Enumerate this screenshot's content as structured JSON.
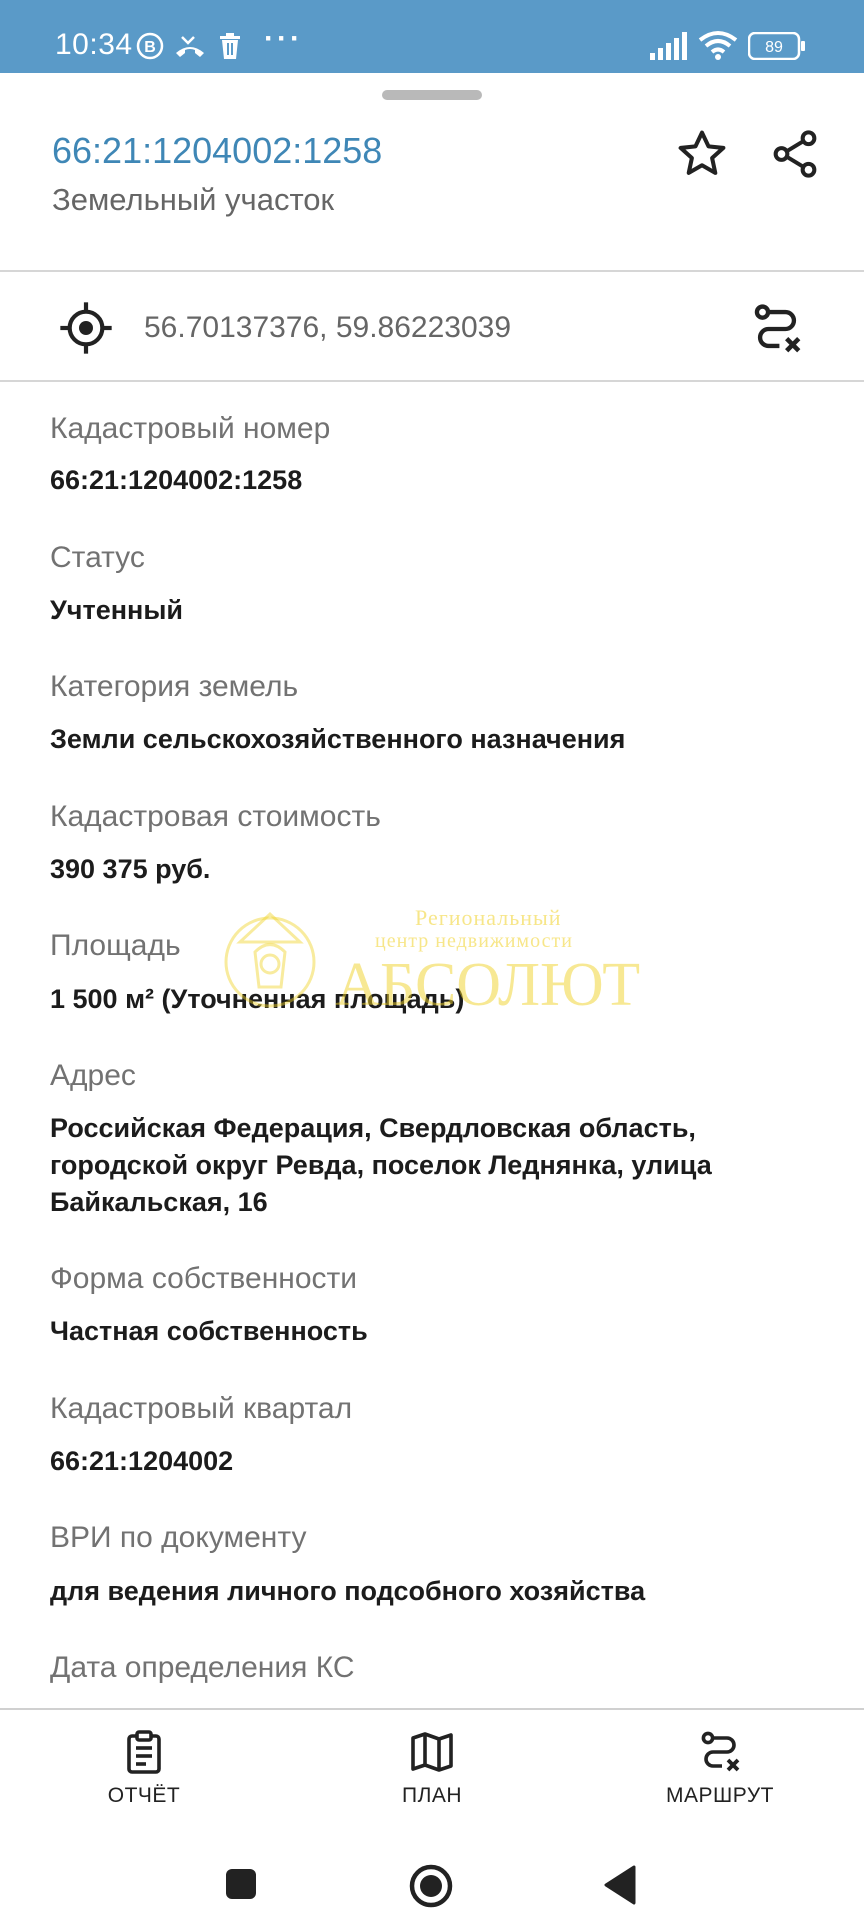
{
  "status_bar": {
    "time": "10:34",
    "battery": "89",
    "icons": [
      "b-circle-icon",
      "missed-call-icon",
      "trash-icon",
      "more-dots-icon",
      "signal-icon",
      "wifi-icon",
      "battery-icon"
    ],
    "color": "#5a9ac8"
  },
  "header": {
    "cadastral_number": "66:21:1204002:1258",
    "object_type": "Земельный участок",
    "accent_color": "#3f87b6"
  },
  "coordinates": {
    "value": "56.70137376, 59.86223039"
  },
  "fields": [
    {
      "label": "Кадастровый номер",
      "value": "66:21:1204002:1258"
    },
    {
      "label": "Статус",
      "value": "Учтенный"
    },
    {
      "label": "Категория земель",
      "value": "Земли сельскохозяйственного назначения"
    },
    {
      "label": "Кадастровая стоимость",
      "value": "390 375 руб."
    },
    {
      "label": "Площадь",
      "value": "1 500 м² (Уточненная площадь)"
    },
    {
      "label": "Адрес",
      "value": "Российская Федерация, Свердловская область, городской округ Ревда, поселок Леднянка, улица Байкальская, 16"
    },
    {
      "label": "Форма собственности",
      "value": "Частная собственность"
    },
    {
      "label": "Кадастровый квартал",
      "value": "66:21:1204002"
    },
    {
      "label": "ВРИ по документу",
      "value": "для ведения личного подсобного хозяйства"
    },
    {
      "label": "Дата определения КС",
      "value": ""
    }
  ],
  "watermark": {
    "line1": "Региональный",
    "line2": "центр недвижимости",
    "line3": "АБСОЛЮТ"
  },
  "bottom_nav": {
    "report": "ОТЧЁТ",
    "plan": "ПЛАН",
    "route": "МАРШРУТ"
  }
}
